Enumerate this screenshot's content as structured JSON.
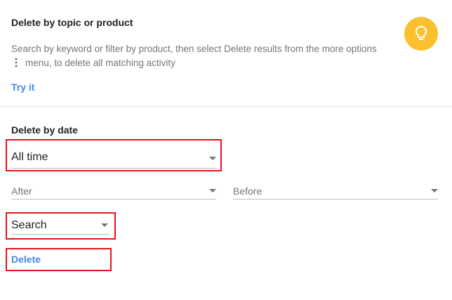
{
  "topic_section": {
    "title": "Delete by topic or product",
    "description_line1": "Search by keyword or filter by product, then select Delete results from the more options",
    "description_line2": "menu, to delete all matching activity",
    "try_it_label": "Try it",
    "icon": "lightbulb-icon",
    "icon_bg_color": "#fbc02d"
  },
  "date_section": {
    "title": "Delete by date",
    "range_select": {
      "value": "All time"
    },
    "after_select": {
      "value": "After"
    },
    "before_select": {
      "value": "Before"
    },
    "product_select": {
      "value": "Search"
    },
    "delete_label": "Delete"
  },
  "colors": {
    "link": "#4285f4",
    "highlight": "#e5141a"
  }
}
